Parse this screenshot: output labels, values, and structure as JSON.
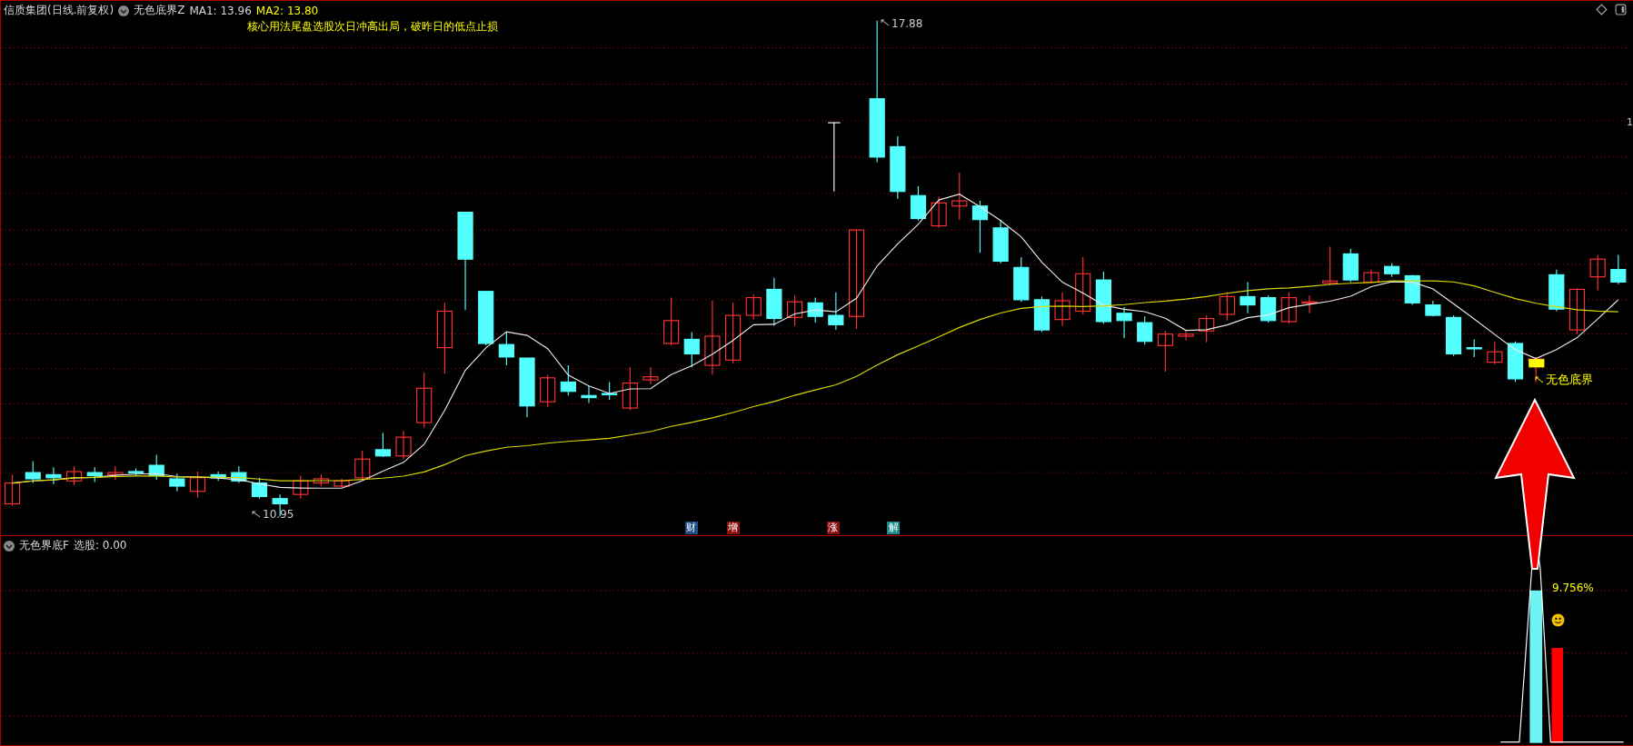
{
  "header": {
    "stock": "信质集团(日线.前复权)",
    "indicator": "无色底界Z",
    "ma1": "MA1: 13.96",
    "ma2": "MA2: 13.80",
    "note": "核心用法尾盘选股次日冲高出局，破昨日的低点止损"
  },
  "axis_label": "1",
  "price_labels": {
    "high": "17.88",
    "low": "10.95"
  },
  "events": [
    {
      "label": "财",
      "color": "#1f4f86"
    },
    {
      "label": "增",
      "color": "#8b1010"
    },
    {
      "label": "涨",
      "color": "#8b1010"
    },
    {
      "label": "解",
      "color": "#1a8a8a"
    }
  ],
  "signal_label": "无色底界",
  "lower": {
    "indicator": "无色界底F",
    "reading": "选股: 0.00",
    "percent": "9.756%"
  }
}
